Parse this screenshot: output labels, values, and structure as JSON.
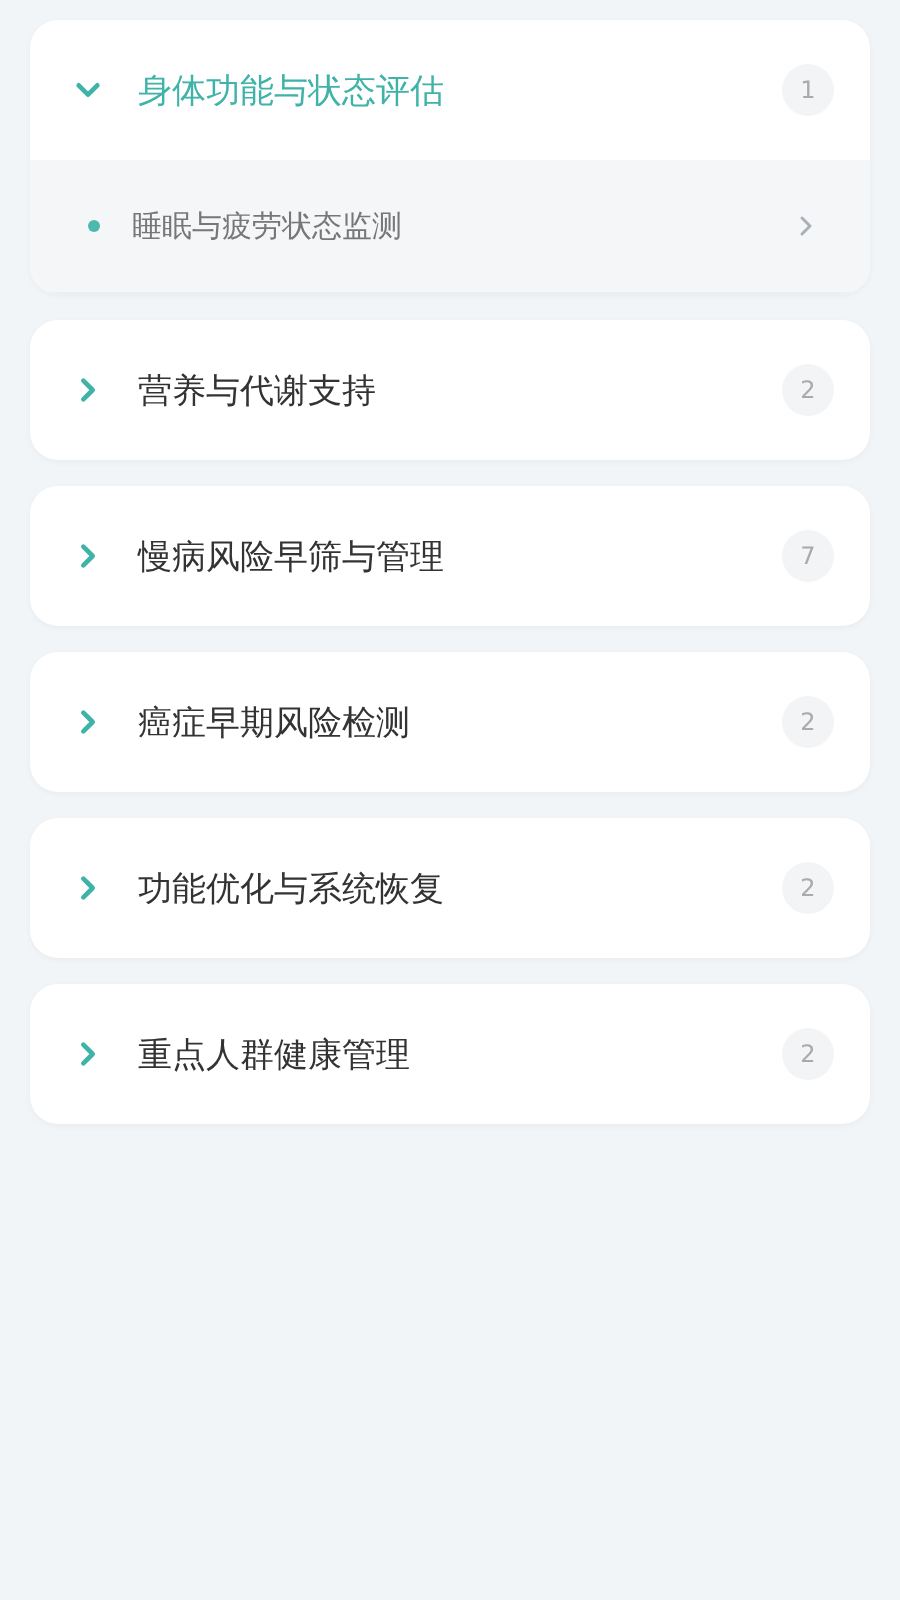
{
  "categories": [
    {
      "title": "身体功能与状态评估",
      "count": "1",
      "expanded": true,
      "children": [
        {
          "title": "睡眠与疲劳状态监测"
        }
      ]
    },
    {
      "title": "营养与代谢支持",
      "count": "2",
      "expanded": false
    },
    {
      "title": "慢病风险早筛与管理",
      "count": "7",
      "expanded": false
    },
    {
      "title": "癌症早期风险检测",
      "count": "2",
      "expanded": false
    },
    {
      "title": "功能优化与系统恢复",
      "count": "2",
      "expanded": false
    },
    {
      "title": "重点人群健康管理",
      "count": "2",
      "expanded": false
    }
  ]
}
